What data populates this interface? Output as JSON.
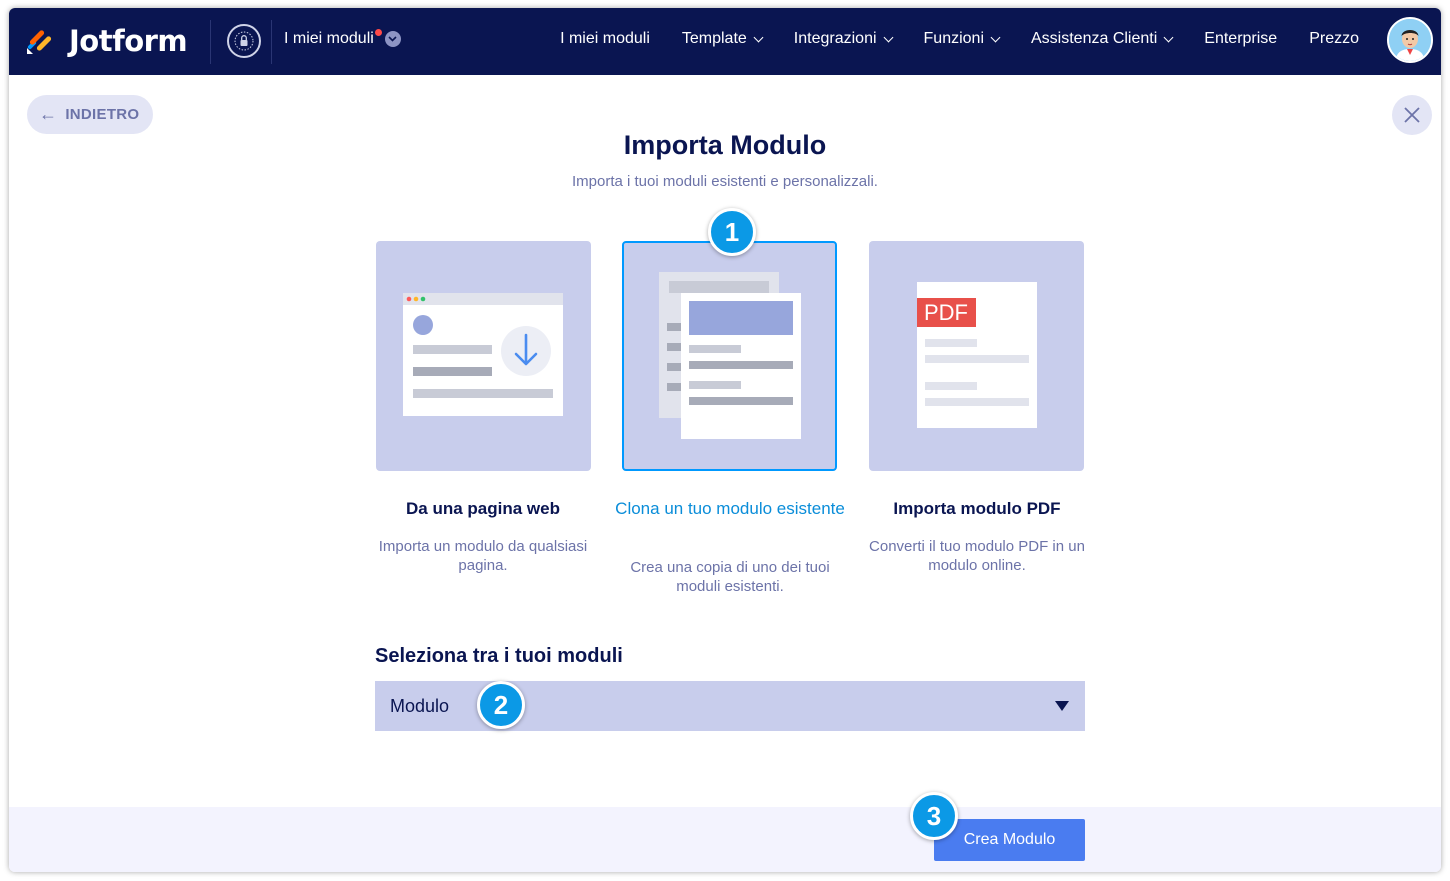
{
  "header": {
    "brand": "Jotform",
    "my_forms": "I miei moduli",
    "nav": [
      {
        "label": "I miei moduli",
        "has_caret": false
      },
      {
        "label": "Template",
        "has_caret": true
      },
      {
        "label": "Integrazioni",
        "has_caret": true
      },
      {
        "label": "Funzioni",
        "has_caret": true
      },
      {
        "label": "Assistenza Clienti",
        "has_caret": true
      },
      {
        "label": "Enterprise",
        "has_caret": false
      },
      {
        "label": "Prezzo",
        "has_caret": false
      }
    ]
  },
  "page": {
    "back_label": "INDIETRO",
    "title": "Importa Modulo",
    "subtitle": "Importa i tuoi moduli esistenti e personalizzali."
  },
  "options": [
    {
      "title": "Da una pagina web",
      "desc": "Importa un modulo da qualsiasi pagina."
    },
    {
      "title": "Clona un tuo modulo esistente",
      "desc": "Crea una copia di uno dei tuoi moduli esistenti."
    },
    {
      "title": "Importa modulo PDF",
      "desc": "Converti il tuo modulo PDF in un modulo online.",
      "badge": "PDF"
    }
  ],
  "select": {
    "label": "Seleziona tra i tuoi moduli",
    "value": "Modulo"
  },
  "steps": [
    "1",
    "2",
    "3"
  ],
  "create_button": "Crea Modulo",
  "colors": {
    "navy": "#0a1551",
    "accent": "#0099ff",
    "card": "#c8cdec",
    "button": "#4a7cf0",
    "pdf_badge": "#e8504a"
  }
}
